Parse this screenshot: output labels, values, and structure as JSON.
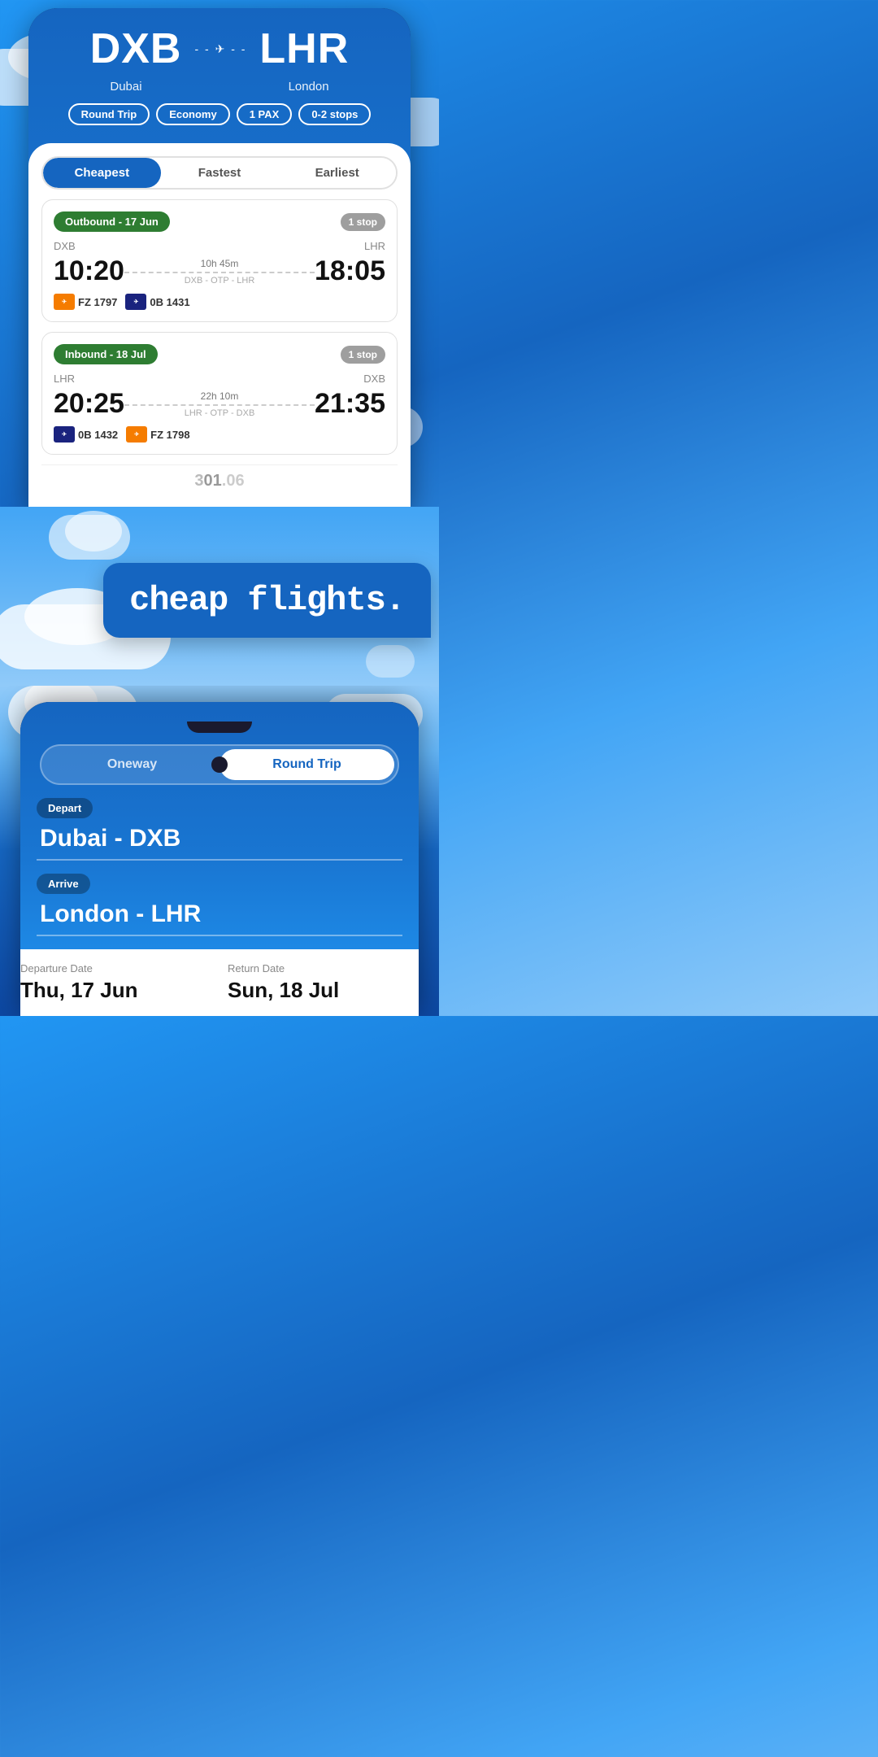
{
  "topPhone": {
    "origin": {
      "code": "DXB",
      "city": "Dubai"
    },
    "destination": {
      "code": "LHR",
      "city": "London"
    },
    "filters": {
      "tripType": "Round Trip",
      "cabin": "Economy",
      "passengers": "1 PAX",
      "stops": "0-2 stops"
    },
    "tabs": [
      {
        "label": "Cheapest",
        "active": true
      },
      {
        "label": "Fastest",
        "active": false
      },
      {
        "label": "Earliest",
        "active": false
      }
    ],
    "flights": [
      {
        "direction": "Outbound - 17 Jun",
        "stops": "1 stop",
        "from": "DXB",
        "to": "LHR",
        "departure": "10:20",
        "arrival": "18:05",
        "duration": "10h 45m",
        "route": "DXB - OTP - LHR",
        "airlines": [
          {
            "code": "FZ 1797",
            "logoColor": "orange",
            "short": "dubai"
          },
          {
            "code": "0B 1431",
            "logoColor": "blue",
            "short": "0B"
          }
        ]
      },
      {
        "direction": "Inbound - 18 Jul",
        "stops": "1 stop",
        "from": "LHR",
        "to": "DXB",
        "departure": "20:25",
        "arrival": "21:35",
        "duration": "22h 10m",
        "route": "LHR - OTP - DXB",
        "airlines": [
          {
            "code": "0B 1432",
            "logoColor": "blue",
            "short": "0B"
          },
          {
            "code": "FZ 1798",
            "logoColor": "orange",
            "short": "dubai"
          }
        ]
      }
    ],
    "partialPrice": "301.06"
  },
  "midSection": {
    "text": "cheap flights."
  },
  "bottomPhone": {
    "tripToggle": {
      "options": [
        "Oneway",
        "Round Trip"
      ],
      "selected": "Round Trip"
    },
    "depart": {
      "label": "Depart",
      "value": "Dubai - DXB"
    },
    "arrive": {
      "label": "Arrive",
      "value": "London - LHR"
    },
    "departureDate": {
      "label": "Departure Date",
      "value": "Thu, 17 Jun"
    },
    "returnDate": {
      "label": "Return Date",
      "value": "Sun, 18 Jul"
    }
  }
}
